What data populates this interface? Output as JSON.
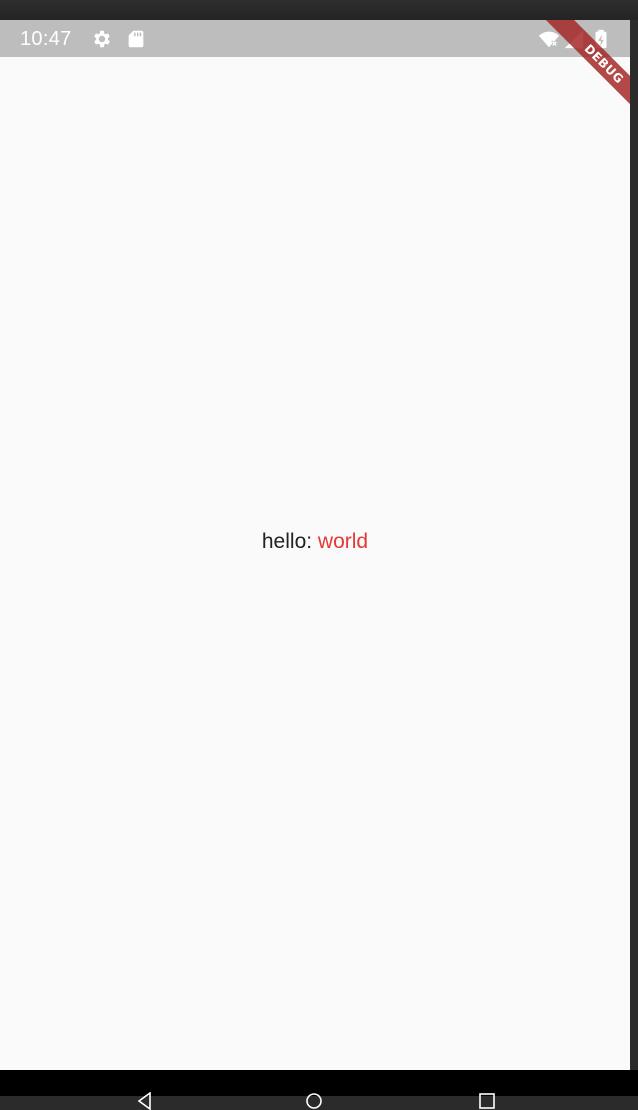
{
  "status_bar": {
    "time": "10:47",
    "left_icons": [
      "gear-icon",
      "sd-card-icon"
    ],
    "right_icons": [
      "wifi-off-icon",
      "signal-icon",
      "battery-charging-icon"
    ],
    "background_color": "#bdbdbd"
  },
  "main": {
    "label": "hello:",
    "value": "world",
    "label_color": "#222222",
    "value_color": "#e53935"
  },
  "debug_banner": {
    "text": "DEBUG",
    "color": "#a52828"
  },
  "nav_bar": {
    "icons": [
      "back-icon",
      "home-icon",
      "recents-icon"
    ]
  }
}
